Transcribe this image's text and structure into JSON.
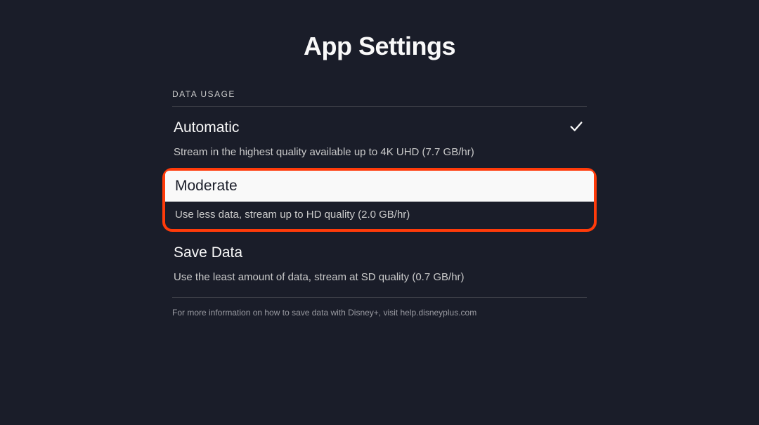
{
  "title": "App Settings",
  "section": {
    "header": "DATA USAGE",
    "options": [
      {
        "title": "Automatic",
        "description": "Stream in the highest quality available up to 4K UHD (7.7 GB/hr)",
        "selected": true,
        "highlighted": false
      },
      {
        "title": "Moderate",
        "description": "Use less data, stream up to HD quality (2.0 GB/hr)",
        "selected": false,
        "highlighted": true
      },
      {
        "title": "Save Data",
        "description": "Use the least amount of data, stream at SD quality (0.7 GB/hr)",
        "selected": false,
        "highlighted": false
      }
    ],
    "footer": "For more information on how to save data with Disney+, visit help.disneyplus.com"
  },
  "icons": {
    "check": "check-icon"
  }
}
